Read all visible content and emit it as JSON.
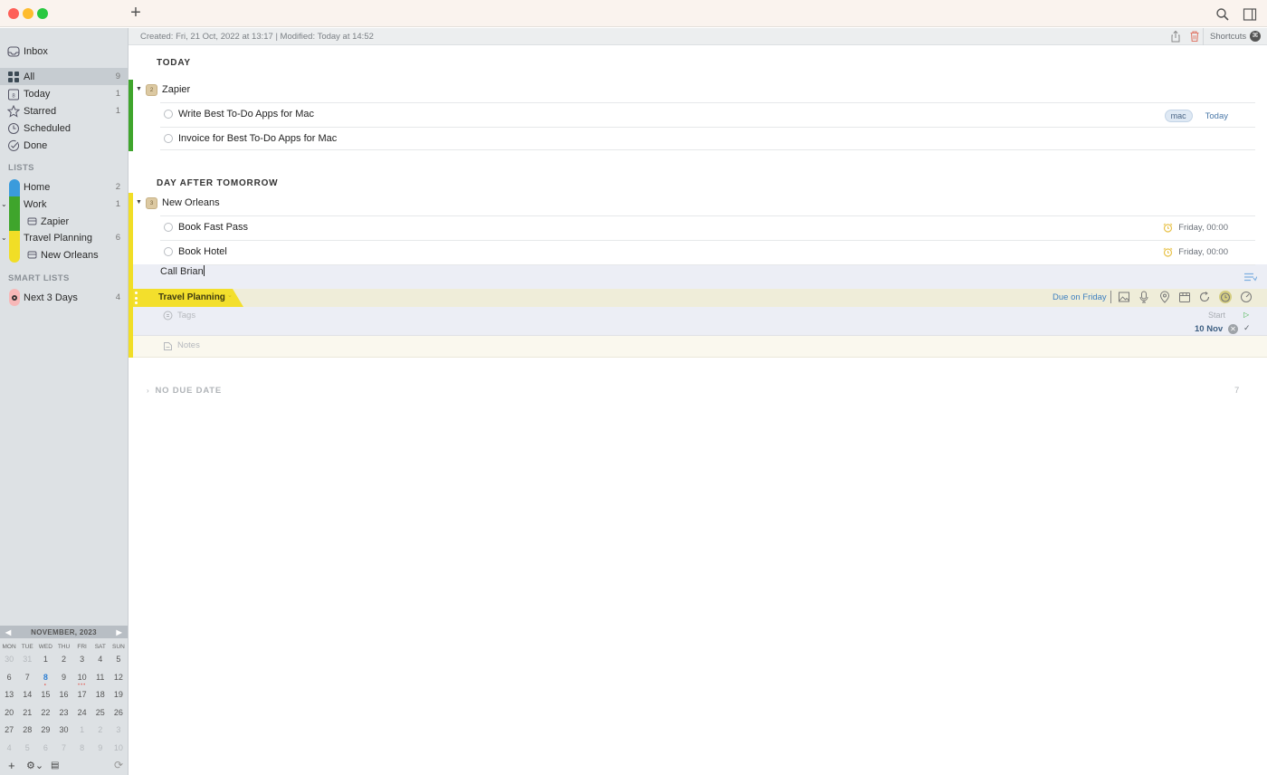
{
  "window": {
    "new_task_label": "+",
    "search_icon": "search-icon",
    "sidebar_toggle_icon": "sidebar-toggle-icon"
  },
  "infobar": {
    "meta": "Created: Fri, 21 Oct, 2022 at 13:17  |  Modified: Today at 14:52",
    "shortcuts_label": "Shortcuts",
    "shortcuts_key": "⌘"
  },
  "sidebar": {
    "inbox": {
      "label": "Inbox"
    },
    "smart": [
      {
        "label": "All",
        "count": "9",
        "icon": "grid-icon"
      },
      {
        "label": "Today",
        "count": "1",
        "icon": "calendar-day-icon",
        "icon_text": "8"
      },
      {
        "label": "Starred",
        "count": "1",
        "icon": "star-icon"
      },
      {
        "label": "Scheduled",
        "count": "",
        "icon": "clock-icon"
      },
      {
        "label": "Done",
        "count": "",
        "icon": "done-check-icon"
      }
    ],
    "lists_header": "LISTS",
    "lists": [
      {
        "label": "Home",
        "count": "2",
        "color": "#3a9bdc"
      },
      {
        "label": "Work",
        "count": "1",
        "color": "#3fa52c"
      },
      {
        "label": "Zapier",
        "count": "",
        "project": true
      },
      {
        "label": "Travel Planning",
        "count": "6",
        "color": "#f1de26"
      },
      {
        "label": "New Orleans",
        "count": "",
        "project": true
      }
    ],
    "smart_lists_header": "SMART LISTS",
    "smart_lists": [
      {
        "label": "Next 3 Days",
        "count": "4",
        "color": "#f7b8b8"
      }
    ]
  },
  "calendar": {
    "month_label": "NOVEMBER, 2023",
    "weekdays": [
      "MON",
      "TUE",
      "WED",
      "THU",
      "FRI",
      "SAT",
      "SUN"
    ],
    "days": [
      {
        "d": "30",
        "dim": true
      },
      {
        "d": "31",
        "dim": true
      },
      {
        "d": "1"
      },
      {
        "d": "2"
      },
      {
        "d": "3"
      },
      {
        "d": "4"
      },
      {
        "d": "5"
      },
      {
        "d": "6"
      },
      {
        "d": "7"
      },
      {
        "d": "8",
        "today": true,
        "dots": "•"
      },
      {
        "d": "9"
      },
      {
        "d": "10",
        "dots": "•••"
      },
      {
        "d": "11"
      },
      {
        "d": "12"
      },
      {
        "d": "13"
      },
      {
        "d": "14"
      },
      {
        "d": "15"
      },
      {
        "d": "16"
      },
      {
        "d": "17"
      },
      {
        "d": "18"
      },
      {
        "d": "19"
      },
      {
        "d": "20"
      },
      {
        "d": "21"
      },
      {
        "d": "22"
      },
      {
        "d": "23"
      },
      {
        "d": "24"
      },
      {
        "d": "25"
      },
      {
        "d": "26"
      },
      {
        "d": "27"
      },
      {
        "d": "28"
      },
      {
        "d": "29"
      },
      {
        "d": "30"
      },
      {
        "d": "1",
        "dim": true
      },
      {
        "d": "2",
        "dim": true
      },
      {
        "d": "3",
        "dim": true
      },
      {
        "d": "4",
        "dim": true
      },
      {
        "d": "5",
        "dim": true
      },
      {
        "d": "6",
        "dim": true
      },
      {
        "d": "7",
        "dim": true
      },
      {
        "d": "8",
        "dim": true
      },
      {
        "d": "9",
        "dim": true
      },
      {
        "d": "10",
        "dim": true
      }
    ]
  },
  "sections": {
    "today": {
      "title": "TODAY",
      "project": {
        "name": "Zapier",
        "badge": "2",
        "color": "#3fa52c"
      },
      "tasks": [
        {
          "title": "Write Best To-Do Apps for Mac",
          "tag": "mac",
          "due": "Today"
        },
        {
          "title": "Invoice for Best To-Do Apps for Mac"
        }
      ]
    },
    "day_after": {
      "title": "DAY AFTER TOMORROW",
      "project": {
        "name": "New Orleans",
        "badge": "3",
        "color": "#f1de26"
      },
      "tasks": [
        {
          "title": "Book Fast Pass",
          "due": "Friday, 00:00"
        },
        {
          "title": "Book Hotel",
          "due": "Friday, 00:00"
        },
        {
          "title": "Call Brian"
        }
      ]
    },
    "no_due": {
      "title": "NO DUE DATE",
      "count": "7"
    }
  },
  "editor": {
    "list_name": "Travel Planning",
    "due_label": "Due on Friday",
    "tags_placeholder": "Tags",
    "notes_placeholder": "Notes",
    "start_label": "Start",
    "date_value": "10 Nov"
  }
}
